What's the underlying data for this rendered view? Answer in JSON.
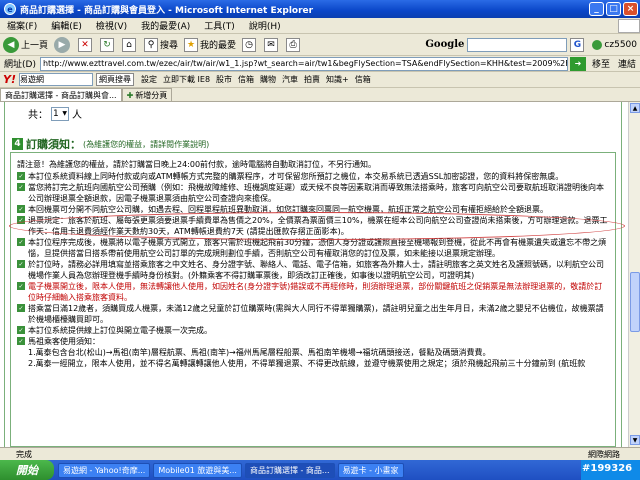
{
  "window": {
    "title": "商品訂購選擇 - 商品訂購與會員登入 - Microsoft Internet Explorer"
  },
  "menu": [
    "檔案(F)",
    "編輯(E)",
    "檢視(V)",
    "我的最愛(A)",
    "工具(T)",
    "說明(H)"
  ],
  "toolbar": {
    "back": "上一頁",
    "search": "搜尋",
    "favorites": "我的最愛",
    "google_label": "Google",
    "google_go": "G",
    "user": "cz5500"
  },
  "address": {
    "label": "網址(D)",
    "url": "http://www.ezttravel.com.tw/ezec/air/tw/air/w1_1.jsp?wt_search=air/tw1&begFlySection=TSA&endFlySection=KHH&test=2009%2F04%2F25&departTime=0600%2C0612%2C0034&flyDay",
    "go": "移至",
    "links": "連結"
  },
  "yahoo": {
    "logo": "Y!",
    "query": "易遊網",
    "search_btn": "網頁搜尋",
    "items": [
      "設定",
      "立即下載 IE8",
      "股市",
      "信箱",
      "購物",
      "汽車",
      "拍賣",
      "知識+",
      "信箱"
    ]
  },
  "tabs": [
    {
      "label": "商品訂購選擇 - 商品訂購與會..."
    },
    {
      "label": "新增分頁"
    }
  ],
  "passenger": {
    "label": "共：",
    "value": "1",
    "unit": "人"
  },
  "notice": {
    "number": "4",
    "title": "訂購須知：",
    "subtitle": "(為維護您的權益，請詳閱作業說明)",
    "intro": "請注意！為維護您的權益，請於訂購當日晚上24:00前付款，逾時電腦將自動取消訂位，不另行通知。",
    "bullets": [
      {
        "text": "本訂位系統資料線上同時付款或向或ATM轉帳方式完整的購票程序，才可保留您所預訂之機位，本交易系統已透過SSL加密認證，您的資料將保密無虞。",
        "red": false
      },
      {
        "text": "當您將訂完之航班向國航空公司預購（例如：飛機故障維修、班機調度延遲）或天候不良等因素取消而導致無法搭乘時，旅客可向航空公司要取航班取消證明後向本公司辦理退票全額退款，因電子機票退票須由航空公司查證向來擔保。",
        "red": false
      },
      {
        "text": "本回機票可分開不同航空公司購，如遇去程、回程單程航班異動取消，如您訂購來回票同一航空機票，航班正常之航空公司有權拒絕給於全額退票。",
        "red": false
      },
      {
        "text": "退票規定：旅客於航班、屬每張更票須要退票手續費單為售價之20%，全價票為票面價三10%，機票在經本公司向航空公司查證尚未搭乘後，方可辦理退款。退票工作天：信用卡退費須經作業天數約30天，ATM轉帳退費約7天 (請提出匯款存摺正面影本)。",
        "red": false,
        "circled": true
      },
      {
        "text": "本訂位程序完成後，機票將以電子機票方式開立，旅客只需於班機起飛前30分鐘，憑個人身分證或護照直接至機場報到登機，從此不再會有機票遺失或遺忘不帶之煩惱，旦提供搭當日搭系帶前使用航空公司訂單的完成規則劃位手續，否則航空公司有權取消您的訂位及票，如未能接以退票規定辦理。",
        "red": false
      },
      {
        "text": "於訂位時，請務必詳用填寫並搭乘旅客之中文姓名、身分證字號、聯絡人、電話、電子信箱，如旅客為外籍人士，請註明旅客之英文姓名及護照號碼，以利航空公司機場作業人員為您辦理登機手續時身份核對。(外籍乘客不得訂購軍票後，即須改訂正確後，如事後以證明航空公司，可證明其)",
        "red": false
      },
      {
        "text": "電子機票開立後，限本人使用，無法轉讓他人使用，如因姓名(身分證字號)錯誤或不再經修時，則須辦理退票，部份關鍵航班之促銷票是無法辦理退票的，敬請於訂位時仔細輸入搭乘旅客資料。",
        "red": true
      },
      {
        "text": "搭乘當日滿12歲者，須購買成人機票，未滿12歲之兒童於訂位購票時(需與大人同行不得單獨購票)，請註明兒童之出生年月日，未滿2歲之嬰兒不佔機位，故機票請於機場櫃檯購買即可。",
        "red": false
      },
      {
        "text": "本訂位系統提供線上訂位與開立電子機票一次完成。",
        "red": false
      },
      {
        "text": "馬祖乘客使用須知：",
        "red": false
      }
    ],
    "list": [
      "1.萬泰包含台北(松山)→馬祖(南竿)層程航票、馬祖(南竿)→福州馬尾層程船票、馬祖南竿機場→福坑碼頭接送，餐點及碼頭消費費。",
      "2.萬泰一經開立，限本人使用，並不得名萬轉讓轉讓他人使用，不得單獨退票、不得更改航線，並遵守機票使用之規定；須於飛機起飛前三十分鐘前到 (航班款"
    ]
  },
  "status": {
    "left": "完成",
    "zone": "網際網路"
  },
  "taskbar": {
    "start": "開始",
    "tasks": [
      "易遊網 - Yahoo!奇摩...",
      "Mobile01 旅遊與美...",
      "商品訂購選擇 - 商品...",
      "易遊卡 - 小畫家"
    ],
    "watermark": "#199326"
  }
}
